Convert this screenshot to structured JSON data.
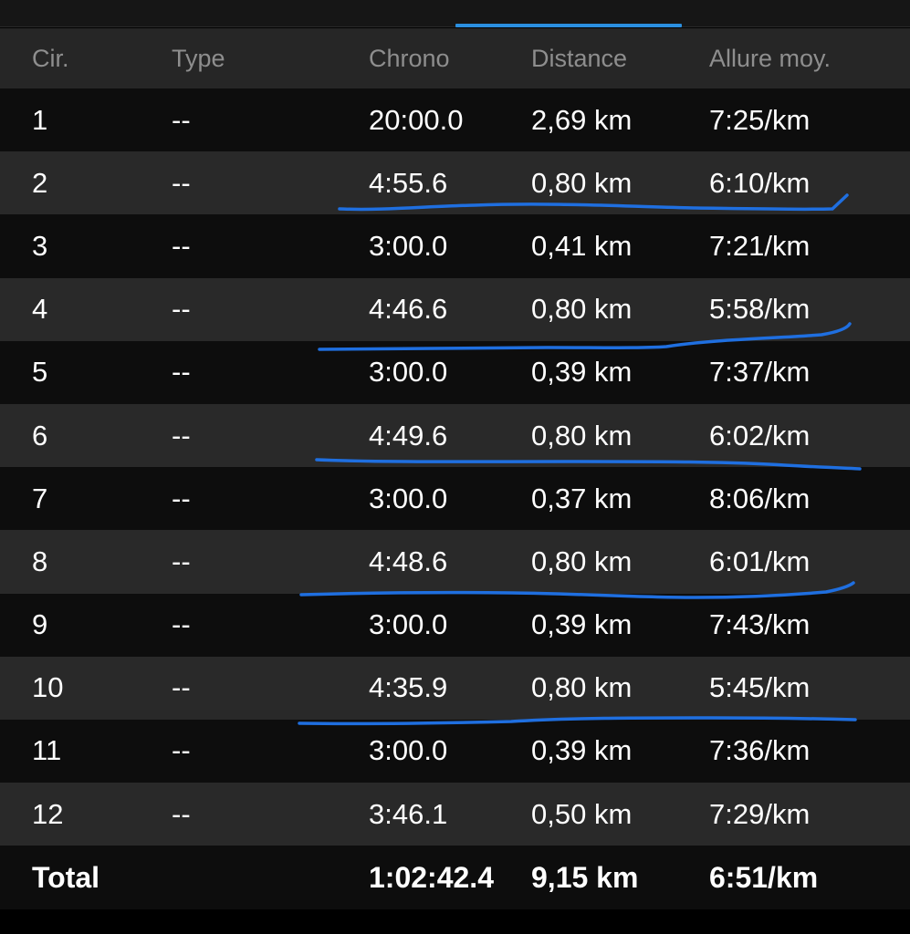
{
  "columns": {
    "lap": "Cir.",
    "type": "Type",
    "chrono": "Chrono",
    "distance": "Distance",
    "pace": "Allure moy."
  },
  "laps": [
    {
      "lap": "1",
      "type": "--",
      "chrono": "20:00.0",
      "distance": "2,69 km",
      "pace": "7:25/km"
    },
    {
      "lap": "2",
      "type": "--",
      "chrono": "4:55.6",
      "distance": "0,80 km",
      "pace": "6:10/km"
    },
    {
      "lap": "3",
      "type": "--",
      "chrono": "3:00.0",
      "distance": "0,41 km",
      "pace": "7:21/km"
    },
    {
      "lap": "4",
      "type": "--",
      "chrono": "4:46.6",
      "distance": "0,80 km",
      "pace": "5:58/km"
    },
    {
      "lap": "5",
      "type": "--",
      "chrono": "3:00.0",
      "distance": "0,39 km",
      "pace": "7:37/km"
    },
    {
      "lap": "6",
      "type": "--",
      "chrono": "4:49.6",
      "distance": "0,80 km",
      "pace": "6:02/km"
    },
    {
      "lap": "7",
      "type": "--",
      "chrono": "3:00.0",
      "distance": "0,37 km",
      "pace": "8:06/km"
    },
    {
      "lap": "8",
      "type": "--",
      "chrono": "4:48.6",
      "distance": "0,80 km",
      "pace": "6:01/km"
    },
    {
      "lap": "9",
      "type": "--",
      "chrono": "3:00.0",
      "distance": "0,39 km",
      "pace": "7:43/km"
    },
    {
      "lap": "10",
      "type": "--",
      "chrono": "4:35.9",
      "distance": "0,80 km",
      "pace": "5:45/km"
    },
    {
      "lap": "11",
      "type": "--",
      "chrono": "3:00.0",
      "distance": "0,39 km",
      "pace": "7:36/km"
    },
    {
      "lap": "12",
      "type": "--",
      "chrono": "3:46.1",
      "distance": "0,50 km",
      "pace": "7:29/km"
    }
  ],
  "total": {
    "label": "Total",
    "chrono": "1:02:42.4",
    "distance": "9,15 km",
    "pace": "6:51/km"
  },
  "colors": {
    "accent": "#2b8fe0",
    "annotation": "#1f6fe0",
    "row_dark": "#0d0d0d",
    "row_light": "#292929",
    "header_text": "#8e8e8e"
  },
  "highlighted_laps": [
    "2",
    "4",
    "6",
    "8",
    "10"
  ]
}
